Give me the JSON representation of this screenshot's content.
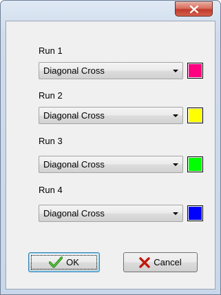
{
  "window": {
    "close_icon": "close-icon"
  },
  "runs": [
    {
      "label": "Run 1",
      "pattern": "Diagonal Cross",
      "color": "#ff0080"
    },
    {
      "label": "Run 2",
      "pattern": "Diagonal Cross",
      "color": "#ffff00"
    },
    {
      "label": "Run 3",
      "pattern": "Diagonal Cross",
      "color": "#00ff00"
    },
    {
      "label": "Run 4",
      "pattern": "Diagonal Cross",
      "color": "#0000ff"
    }
  ],
  "buttons": {
    "ok_label": "OK",
    "ok_icon": "check-icon",
    "cancel_label": "Cancel",
    "cancel_icon": "x-icon"
  }
}
